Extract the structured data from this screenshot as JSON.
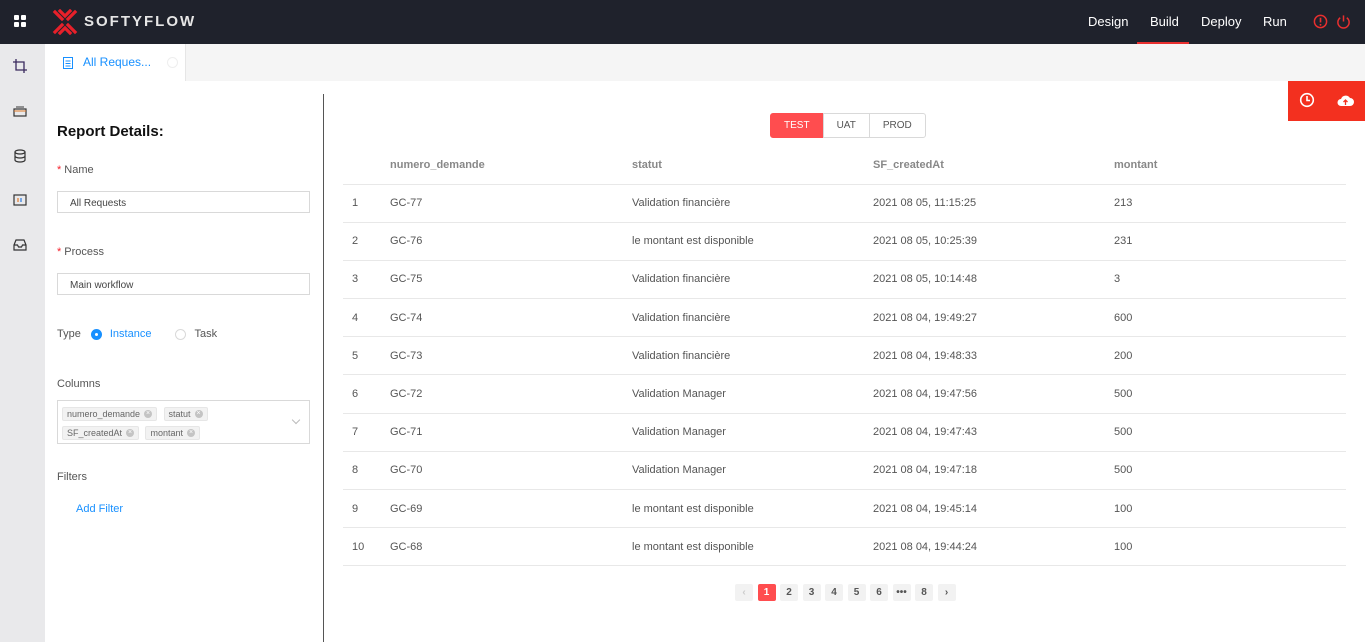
{
  "header": {
    "brand": "SOFTYFLOW",
    "nav": [
      {
        "label": "Design",
        "active": false
      },
      {
        "label": "Build",
        "active": true
      },
      {
        "label": "Deploy",
        "active": false
      },
      {
        "label": "Run",
        "active": false
      }
    ],
    "icons": [
      "alert-icon",
      "power-icon"
    ],
    "accent": "#e82f2f"
  },
  "sidebar": {
    "icons": [
      "crop-icon",
      "layers-icon",
      "database-icon",
      "report-icon",
      "inbox-icon"
    ]
  },
  "tabs": [
    {
      "label": "All Reques...",
      "active": true
    }
  ],
  "report": {
    "title": "Report Details:",
    "name_label": "Name",
    "name_value": "All Requests",
    "process_label": "Process",
    "process_value": "Main workflow",
    "type_label": "Type",
    "type_options": [
      {
        "label": "Instance",
        "selected": true
      },
      {
        "label": "Task",
        "selected": false
      }
    ],
    "columns_label": "Columns",
    "columns": [
      "numero_demande",
      "statut",
      "SF_createdAt",
      "montant"
    ],
    "filters_label": "Filters",
    "add_filter": "Add Filter"
  },
  "actions": [
    "history-icon",
    "cloud-upload-icon"
  ],
  "environments": [
    {
      "label": "TEST",
      "active": true
    },
    {
      "label": "UAT",
      "active": false
    },
    {
      "label": "PROD",
      "active": false
    }
  ],
  "table": {
    "headers": [
      "",
      "numero_demande",
      "statut",
      "SF_createdAt",
      "montant"
    ],
    "rows": [
      [
        "1",
        "GC-77",
        "Validation financière",
        "2021 08 05, 11:15:25",
        "213"
      ],
      [
        "2",
        "GC-76",
        "le montant est disponible",
        "2021 08 05, 10:25:39",
        "231"
      ],
      [
        "3",
        "GC-75",
        "Validation financière",
        "2021 08 05, 10:14:48",
        "3"
      ],
      [
        "4",
        "GC-74",
        "Validation financière",
        "2021 08 04, 19:49:27",
        "600"
      ],
      [
        "5",
        "GC-73",
        "Validation financière",
        "2021 08 04, 19:48:33",
        "200"
      ],
      [
        "6",
        "GC-72",
        "Validation Manager",
        "2021 08 04, 19:47:56",
        "500"
      ],
      [
        "7",
        "GC-71",
        "Validation Manager",
        "2021 08 04, 19:47:43",
        "500"
      ],
      [
        "8",
        "GC-70",
        "Validation Manager",
        "2021 08 04, 19:47:18",
        "500"
      ],
      [
        "9",
        "GC-69",
        "le montant est disponible",
        "2021 08 04, 19:45:14",
        "100"
      ],
      [
        "10",
        "GC-68",
        "le montant est disponible",
        "2021 08 04, 19:44:24",
        "100"
      ]
    ]
  },
  "pagination": {
    "prev": "‹",
    "pages": [
      "1",
      "2",
      "3",
      "4",
      "5",
      "6",
      "•••",
      "8"
    ],
    "current": "1",
    "next": "›"
  }
}
